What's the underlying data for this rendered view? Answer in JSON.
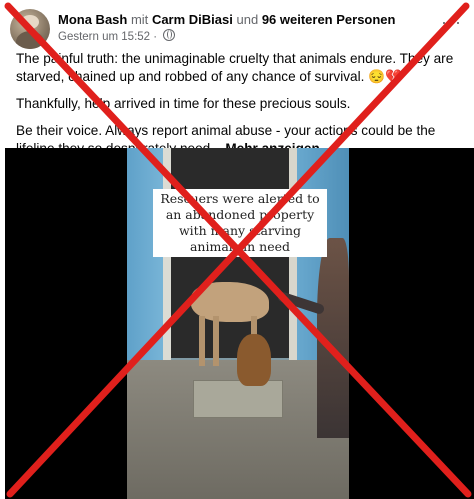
{
  "post": {
    "author": "Mona Bash",
    "with_word": "mit",
    "tagged": "Carm DiBiasi",
    "and_word": "und",
    "others": "96 weiteren Personen",
    "timestamp": "Gestern um 15:52",
    "separator": "·",
    "more_menu": "···"
  },
  "body": {
    "paragraph1": "The painful truth: the unimaginable cruelty that animals endure. They are starved, chained up and robbed of any chance of survival. 😔💔",
    "paragraph2": "Thankfully, help arrived in time for these precious souls.",
    "paragraph3": "Be their voice. Always report animal abuse - your actions could be the lifeline they so desperately need...",
    "see_more": "Mehr anzeigen"
  },
  "video": {
    "caption": "Rescuers were alerted to an abandoned property with many starving animals in need"
  },
  "overlay": {
    "cross_color": "#e0201c"
  }
}
